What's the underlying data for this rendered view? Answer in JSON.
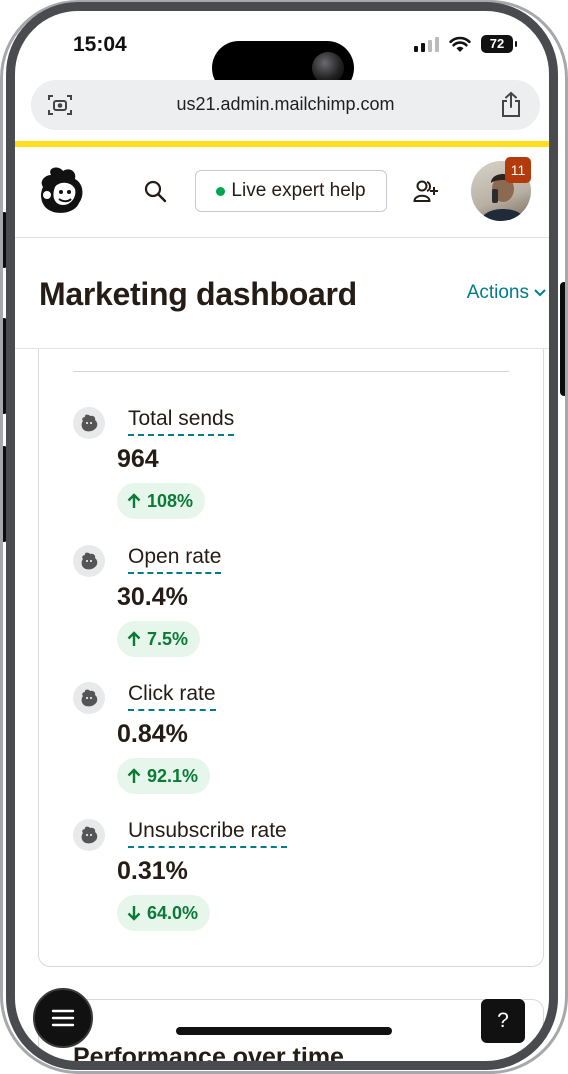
{
  "status_bar": {
    "time": "15:04",
    "battery": "72"
  },
  "browser": {
    "url": "us21.admin.mailchimp.com"
  },
  "header": {
    "live_help": "Live expert help",
    "notification_count": "11"
  },
  "page": {
    "title": "Marketing dashboard",
    "actions_label": "Actions"
  },
  "metrics": [
    {
      "label": "Total sends",
      "value": "964",
      "change": "108%",
      "direction": "up"
    },
    {
      "label": "Open rate",
      "value": "30.4%",
      "change": "7.5%",
      "direction": "up"
    },
    {
      "label": "Click rate",
      "value": "0.84%",
      "change": "92.1%",
      "direction": "up"
    },
    {
      "label": "Unsubscribe rate",
      "value": "0.31%",
      "change": "64.0%",
      "direction": "down"
    }
  ],
  "next_section": {
    "title": "Performance over time"
  },
  "help_button": "?",
  "colors": {
    "accent": "#007c89",
    "brand_yellow": "#ffe01b",
    "positive": "#0b7a37",
    "positive_bg": "#e6f6ea",
    "badge": "#b33a0a"
  }
}
